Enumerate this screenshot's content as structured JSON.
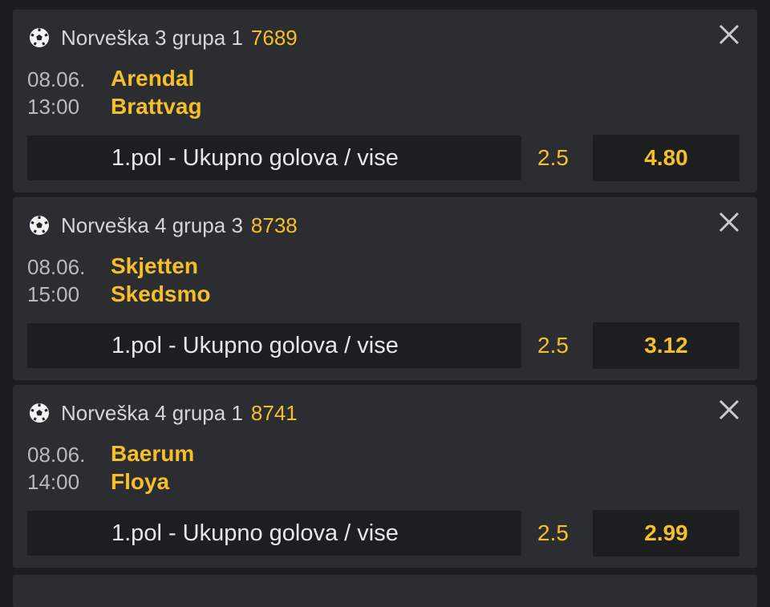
{
  "bets": [
    {
      "league": "Norveška 3 grupa 1",
      "code": "7689",
      "date": "08.06.",
      "time": "13:00",
      "home": "Arendal",
      "away": "Brattvag",
      "market": "1.pol - Ukupno golova / vise",
      "line": "2.5",
      "odd": "4.80",
      "icon": "soccer-ball-icon"
    },
    {
      "league": "Norveška 4 grupa 3",
      "code": "8738",
      "date": "08.06.",
      "time": "15:00",
      "home": "Skjetten",
      "away": "Skedsmo",
      "market": "1.pol - Ukupno golova / vise",
      "line": "2.5",
      "odd": "3.12",
      "icon": "soccer-ball-icon"
    },
    {
      "league": "Norveška 4 grupa 1",
      "code": "8741",
      "date": "08.06.",
      "time": "14:00",
      "home": "Baerum",
      "away": "Floya",
      "market": "1.pol - Ukupno golova / vise",
      "line": "2.5",
      "odd": "2.99",
      "icon": "soccer-ball-icon"
    }
  ],
  "colors": {
    "background": "#1b1d1f",
    "card": "#2b2d30",
    "accent": "#f5bf2a",
    "field": "#1c1e20"
  }
}
